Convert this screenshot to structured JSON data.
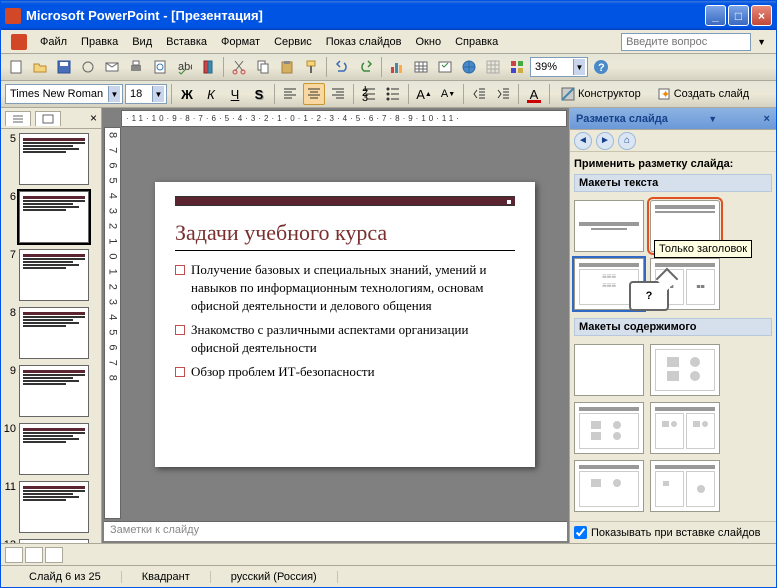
{
  "titlebar": {
    "title": "Microsoft PowerPoint - [Презентация]"
  },
  "menu": {
    "file": "Файл",
    "edit": "Правка",
    "view": "Вид",
    "insert": "Вставка",
    "format": "Формат",
    "service": "Сервис",
    "show": "Показ слайдов",
    "window": "Окно",
    "help": "Справка",
    "help_placeholder": "Введите вопрос"
  },
  "toolbar": {
    "zoom": "39%"
  },
  "format": {
    "font": "Times New Roman",
    "size": "18",
    "designer": "Конструктор",
    "new_slide": "Создать слайд"
  },
  "thumbs": {
    "start": 5,
    "count": 8,
    "selected": 6
  },
  "slide": {
    "title": "Задачи учебного курса",
    "bullets": [
      "Получение базовых и специальных знаний, умений и навыков по информационным технологиям, основам офисной деятельности и делового общения",
      "Знакомство с различными аспектами организации офисной деятельности",
      "Обзор проблем ИТ-безопасности"
    ]
  },
  "notes": {
    "placeholder": "Заметки к слайду"
  },
  "taskpane": {
    "title": "Разметка слайда",
    "apply": "Применить разметку слайда:",
    "sect_text": "Макеты текста",
    "sect_content": "Макеты содержимого",
    "tooltip": "Только заголовок",
    "callout": "?",
    "show_on_insert": "Показывать при вставке слайдов"
  },
  "status": {
    "slide": "Слайд 6 из 25",
    "master": "Квадрант",
    "lang": "русский (Россия)"
  }
}
